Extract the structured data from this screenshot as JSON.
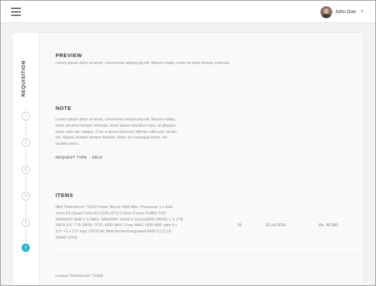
{
  "header": {
    "user_name": "John Doe"
  },
  "rail": {
    "title": "REQUISITION",
    "steps": [
      "1",
      "2",
      "3",
      "4",
      "5",
      "6"
    ],
    "active_step": 6
  },
  "preview": {
    "title": "PREVIEW",
    "text": "Lorem ipsum dolor sit amet, consectetur adipiscing elit. Mauris mattis, tortor sit amet tempor vehicula."
  },
  "note": {
    "title": "NOTE",
    "lines": [
      "Lorem ipsum dolor sit amet, consectetur adipiscing elit. Mauris mattis,",
      "tortor sit amet tempor vehicula, tortor ipsum faucibus nunc, id aliquam",
      "lacus odio nec magna. Cras a ipsum placerat, efficitur nibh sed, iaculis",
      "elit. Mauris semper tempor facilisis. Nunc at consequat tortor, vel",
      "facilisis tortor."
    ],
    "request_type_label": "REQUEST TYPE",
    "request_type_value": "- SELF"
  },
  "items": {
    "title": "ITEMS",
    "rows": [
      {
        "description_lines": [
          "IBM ThinkServer TS150 Tower Server With Max. Processor 1 x Intel",
          "Xeon E3 (Quad Core) E3-1225 v5*(3.3 GHz /Cache 8 MB)/ STD",
          "MEMORY 8GB X 1/ MAX. MEMORY 64GB 4 Slots/HARD DRIVE 1 X 1TB",
          "SATA 3.5\" 7.2k SATA / STD. HDD BAY/ 3 bay MAX. HDD BAY upto 4 x",
          "3.5\" +1 x 2.5\" bay/ OPTICAL Multi Burner/Integrated RAID 0,1,5,10",
          "(RAID 1210)."
        ],
        "qty": "01",
        "date": "10 Jul 2019",
        "price": "Rs. 45,000"
      },
      {
        "description_lines": [
          "Lenovo ThinkServer TS450"
        ]
      }
    ]
  }
}
